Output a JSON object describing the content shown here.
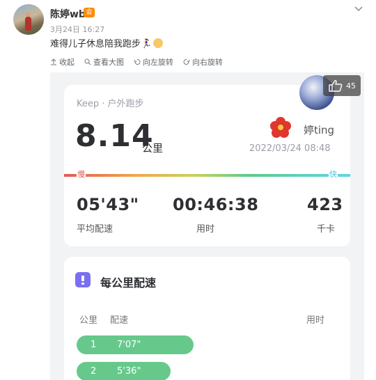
{
  "post": {
    "username": "陈婷wb",
    "vip_badge": "会",
    "timestamp": "3月24日 16:27",
    "text": "难得儿子休息陪我跑步🏃‍♀️"
  },
  "toolbar": {
    "collapse": "收起",
    "view_large": "查看大图",
    "rotate_left": "向左旋转",
    "rotate_right": "向右旋转"
  },
  "like": {
    "count": "45"
  },
  "run": {
    "app_label": "Keep · 户外跑步",
    "distance": "8.14",
    "distance_unit": "公里",
    "user_tag": "婷ting",
    "date": "2022/03/24 08:48",
    "slow_label": "慢",
    "fast_label": "快",
    "pace": "05'43\"",
    "pace_label": "平均配速",
    "duration": "00:46:38",
    "duration_label": "用时",
    "calories": "423",
    "calories_label": "千卡"
  },
  "splits": {
    "title": "每公里配速",
    "col_km": "公里",
    "col_pace": "配速",
    "col_time": "用时",
    "rows": [
      {
        "km": "1",
        "pace": "7'07\""
      },
      {
        "km": "2",
        "pace": "5'36\""
      }
    ]
  },
  "colors": {
    "accent_green": "#66c98b",
    "title_purple": "#7a6ff0"
  }
}
